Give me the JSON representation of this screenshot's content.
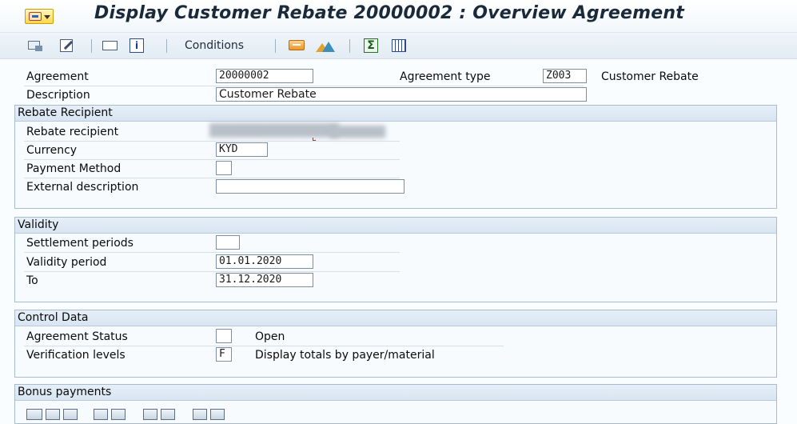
{
  "window": {
    "title": "Display Customer Rebate 20000002 : Overview Agreement"
  },
  "toolbar": {
    "conditions_label": "Conditions"
  },
  "header": {
    "agreement_label": "Agreement",
    "agreement_value": "20000002",
    "agreement_type_label": "Agreement type",
    "agreement_type_value": "Z003",
    "agreement_type_text": "Customer Rebate",
    "description_label": "Description",
    "description_value": "Customer Rebate"
  },
  "rebate_recipient": {
    "title": "Rebate Recipient",
    "recipient_label": "Rebate recipient",
    "currency_label": "Currency",
    "currency_value": "KYD",
    "payment_method_label": "Payment Method",
    "payment_method_value": "",
    "external_description_label": "External description",
    "external_description_value": ""
  },
  "validity": {
    "title": "Validity",
    "settlement_periods_label": "Settlement periods",
    "settlement_periods_value": "",
    "validity_period_label": "Validity period",
    "validity_from": "01.01.2020",
    "to_label": "To",
    "validity_to": "31.12.2020"
  },
  "control_data": {
    "title": "Control Data",
    "status_label": "Agreement Status",
    "status_value": "",
    "status_text": "Open",
    "verification_label": "Verification levels",
    "verification_value": "F",
    "verification_text": "Display totals by payer/material"
  },
  "bonus_payments": {
    "title": "Bonus payments"
  }
}
